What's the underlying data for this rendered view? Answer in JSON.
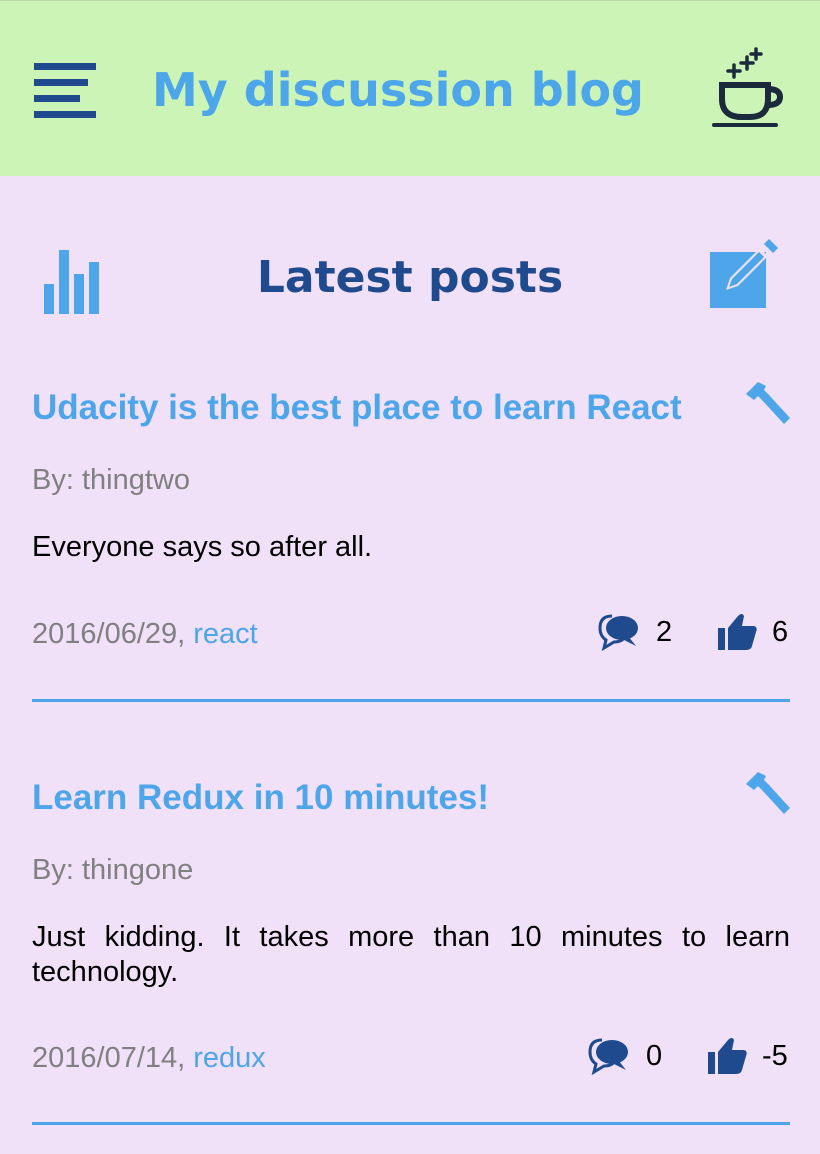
{
  "header": {
    "title": "My discussion blog",
    "menu_icon": "hamburger-menu-icon",
    "coffee_icon": "coffee-cup-icon"
  },
  "toolbar": {
    "title": "Latest posts",
    "stats_icon": "bar-chart-icon",
    "new_post_icon": "edit-square-icon"
  },
  "posts": [
    {
      "title": "Udacity is the best place to learn React",
      "author": "By: thingtwo",
      "body": "Everyone says so after all.",
      "date": "2016/06/29,",
      "category": "react",
      "comments": "2",
      "votes": "6"
    },
    {
      "title": "Learn Redux in 10 minutes!",
      "author": "By: thingone",
      "body": "Just kidding. It takes more than 10 minutes to learn technology.",
      "date": "2016/07/14,",
      "category": "redux",
      "comments": "0",
      "votes": "-5"
    }
  ],
  "colors": {
    "header_bg": "#ccf4b6",
    "page_bg": "#f0e0f8",
    "accent_light": "#4da6ea",
    "accent_dark": "#1f4a8e"
  }
}
